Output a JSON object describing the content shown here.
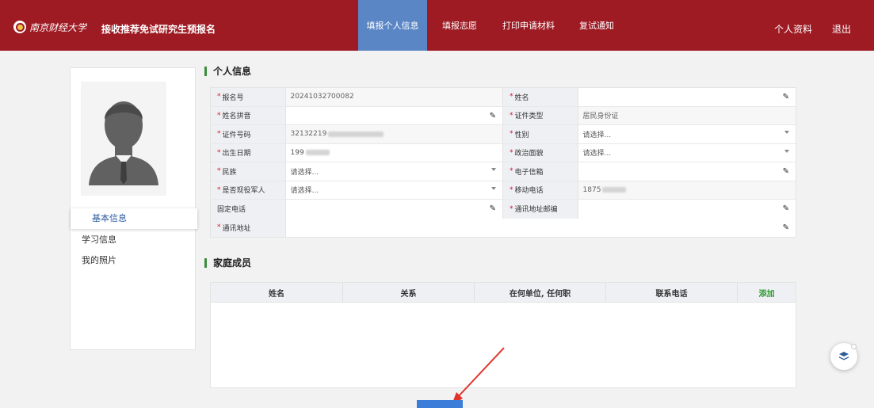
{
  "header": {
    "logo_text": "南京财经大学",
    "app_title": "接收推荐免试研究生预报名",
    "tabs": [
      {
        "label": "填报个人信息",
        "active": true
      },
      {
        "label": "填报志愿",
        "active": false
      },
      {
        "label": "打印申请材料",
        "active": false
      },
      {
        "label": "复试通知",
        "active": false
      }
    ],
    "profile": "个人资料",
    "logout": "退出",
    "accent_color": "#9e1b24",
    "active_tab_color": "#5a86c6"
  },
  "sidebar": {
    "items": [
      {
        "label": "基本信息",
        "active": true
      },
      {
        "label": "学习信息",
        "active": false
      },
      {
        "label": "我的照片",
        "active": false
      }
    ]
  },
  "personal": {
    "title": "个人信息",
    "rows": [
      {
        "l1": "报名号",
        "r1": true,
        "v1": "20241032700082",
        "t1": "gray",
        "l2": "姓名",
        "r2": true,
        "v2": "",
        "t2": "edit"
      },
      {
        "l1": "姓名拼音",
        "r1": true,
        "v1": "",
        "t1": "edit",
        "l2": "证件类型",
        "r2": true,
        "v2": "居民身份证",
        "t2": "gray"
      },
      {
        "l1": "证件号码",
        "r1": true,
        "v1": "32132219",
        "t1": "gray",
        "l2": "性别",
        "r2": true,
        "v2": "请选择...",
        "t2": "select"
      },
      {
        "l1": "出生日期",
        "r1": true,
        "v1": "199",
        "t1": "plain",
        "l2": "政治面貌",
        "r2": true,
        "v2": "请选择...",
        "t2": "select"
      },
      {
        "l1": "民族",
        "r1": true,
        "v1": "请选择...",
        "t1": "select",
        "l2": "电子信箱",
        "r2": true,
        "v2": "",
        "t2": "edit"
      },
      {
        "l1": "是否现役军人",
        "r1": true,
        "v1": "请选择...",
        "t1": "select",
        "l2": "移动电话",
        "r2": true,
        "v2": "1875",
        "t2": "gray"
      },
      {
        "l1": "固定电话",
        "r1": false,
        "v1": "",
        "t1": "edit",
        "l2": "通讯地址邮编",
        "r2": true,
        "v2": "",
        "t2": "edit"
      }
    ],
    "address_label": "通讯地址",
    "address_value": ""
  },
  "family": {
    "title": "家庭成员",
    "columns": [
      "姓名",
      "关系",
      "在何单位, 任何职",
      "联系电话"
    ],
    "add_label": "添加"
  }
}
